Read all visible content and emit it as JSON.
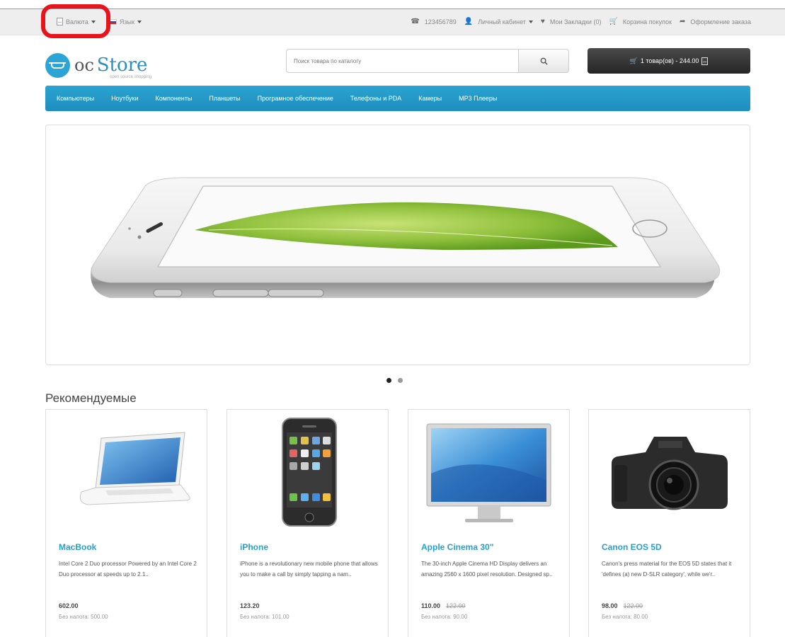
{
  "topbar": {
    "currency_label": "Валюта",
    "language_label": "Язык",
    "phone": "123456789",
    "account_label": "Личный кабинет",
    "wishlist_label": "Мои Закладки (0)",
    "cart_label": "Корзина покупок",
    "checkout_label": "Оформление заказа"
  },
  "logo": {
    "oc": "oc",
    "store": "Store",
    "sub": "open source shopping"
  },
  "search": {
    "placeholder": "Поиск товара по каталогу"
  },
  "cart": {
    "label": "1 товар(ов) - 244.00"
  },
  "menu": {
    "items": [
      "Компьютеры",
      "Ноутбуки",
      "Компоненты",
      "Планшеты",
      "Програмное обеспечение",
      "Телефоны и PDA",
      "Камеры",
      "MP3 Плееры"
    ]
  },
  "slider": {
    "dots_total": 2,
    "active_dot": 1
  },
  "featured_title": "Рекомендуемые",
  "products": [
    {
      "name": "MacBook",
      "description": "Intel Core 2 Duo processor Powered by an Intel Core 2 Duo processor at speeds up to 2.1..",
      "price": "602.00",
      "old_price": "",
      "tax": "Без налога: 500.00"
    },
    {
      "name": "iPhone",
      "description": "iPhone is a revolutionary new mobile phone that allows you to make a call by simply tapping a nam..",
      "price": "123.20",
      "old_price": "",
      "tax": "Без налога: 101.00"
    },
    {
      "name": "Apple Cinema 30\"",
      "description": "The 30-inch Apple Cinema HD Display delivers an amazing 2560 x 1600 pixel resolution. Designed sp..",
      "price": "110.00",
      "old_price": "122.00",
      "tax": "Без налога: 90.00"
    },
    {
      "name": "Canon EOS 5D",
      "description": "Canon's press material for the EOS 5D states that it 'defines (a) new D-SLR category', while we'r..",
      "price": "98.00",
      "old_price": "122.00",
      "tax": "Без налога: 80.00"
    }
  ]
}
